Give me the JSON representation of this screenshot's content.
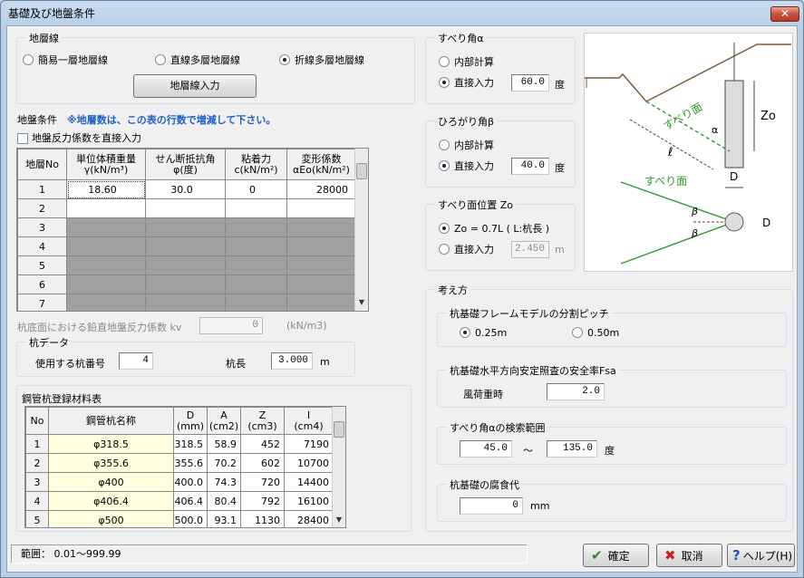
{
  "window": {
    "title": "基礎及び地盤条件",
    "close": "✕"
  },
  "layer": {
    "group": "地層線",
    "options": [
      "簡易一層地層線",
      "直線多層地層線",
      "折線多層地層線"
    ],
    "selected": 2,
    "button": "地層線入力"
  },
  "ground": {
    "label": "地盤条件",
    "note": "※地層数は、この表の行数で増減して下さい。",
    "check": "地盤反力係数を直接入力",
    "headers": [
      [
        "地層No",
        ""
      ],
      [
        "単位体積重量",
        "γ(kN/m³)"
      ],
      [
        "せん断抵抗角",
        "φ(度)"
      ],
      [
        "粘着力",
        "c(kN/m²)"
      ],
      [
        "変形係数",
        "αEo(kN/m²)"
      ]
    ],
    "rows": [
      [
        "1",
        "18.60",
        "30.0",
        "0",
        "28000"
      ],
      [
        "2",
        "",
        "",
        "",
        ""
      ],
      [
        "3",
        "",
        "",
        "",
        ""
      ],
      [
        "4",
        "",
        "",
        "",
        ""
      ],
      [
        "5",
        "",
        "",
        "",
        ""
      ],
      [
        "6",
        "",
        "",
        "",
        ""
      ],
      [
        "7",
        "",
        "",
        "",
        ""
      ]
    ]
  },
  "kv": {
    "label": "杭底面における鉛直地盤反力係数 kv",
    "value": "0",
    "unit": "(kN/m3)"
  },
  "pile": {
    "group": "杭データ",
    "num_label": "使用する杭番号",
    "num": "4",
    "len_label": "杭長",
    "len": "3.000",
    "len_unit": "m"
  },
  "steel": {
    "group": "鋼管杭登録材料表",
    "headers": [
      [
        "No",
        ""
      ],
      [
        "鋼管杭名称",
        ""
      ],
      [
        "D",
        "(mm)"
      ],
      [
        "A",
        "(cm2)"
      ],
      [
        "Z",
        "(cm3)"
      ],
      [
        "I",
        "(cm4)"
      ]
    ],
    "rows": [
      [
        "1",
        "φ318.5",
        "318.5",
        "58.9",
        "452",
        "7190"
      ],
      [
        "2",
        "φ355.6",
        "355.6",
        "70.2",
        "602",
        "10700"
      ],
      [
        "3",
        "φ400",
        "400.0",
        "74.3",
        "720",
        "14400"
      ],
      [
        "4",
        "φ406.4",
        "406.4",
        "80.4",
        "792",
        "16100"
      ],
      [
        "5",
        "φ500",
        "500.0",
        "93.1",
        "1130",
        "28400"
      ]
    ]
  },
  "slip": {
    "group": "すべり角α",
    "opt1": "内部計算",
    "opt2": "直接入力",
    "value": "60.0",
    "unit": "度"
  },
  "spread": {
    "group": "ひろがり角β",
    "opt1": "内部計算",
    "opt2": "直接入力",
    "value": "40.0",
    "unit": "度"
  },
  "pos": {
    "group": "すべり面位置 Zo",
    "opt1": "Zo = 0.7L ( L:杭長 )",
    "opt2": "直接入力",
    "value": "2.450",
    "unit": "m"
  },
  "fig": {
    "slip_face": "すべり面",
    "zo": "Zo",
    "d": "D",
    "alpha": "α",
    "l": "ℓ",
    "beta": "β"
  },
  "approach": {
    "group": "考え方",
    "pitch": {
      "group": "杭基礎フレームモデルの分割ピッチ",
      "opt1": "0.25m",
      "opt2": "0.50m"
    },
    "fsa": {
      "group": "杭基礎水平方向安定照査の安全率Fsa",
      "label": "風荷重時",
      "value": "2.0"
    },
    "range": {
      "group": "すべり角αの検索範囲",
      "from": "45.0",
      "sep": "～",
      "to": "135.0",
      "unit": "度"
    },
    "corr": {
      "group": "杭基礎の腐食代",
      "value": "0",
      "unit": "mm"
    }
  },
  "status": "範囲：  0.01〜999.99",
  "buttons": {
    "ok": "確定",
    "cancel": "取消",
    "help": "ヘルプ(H)"
  },
  "colors": {
    "ok": "#2a8a2a",
    "cancel": "#c0281c",
    "help": "#1a56b8",
    "note": "#1f5fc8"
  }
}
